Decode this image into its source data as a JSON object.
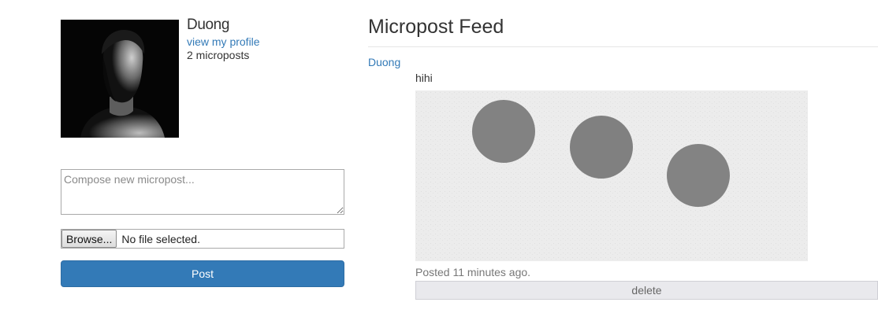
{
  "user": {
    "name": "Duong",
    "profile_link": "view my profile",
    "micropost_count": "2 microposts"
  },
  "compose": {
    "placeholder": "Compose new micropost...",
    "browse_label": "Browse...",
    "file_status": "No file selected.",
    "post_label": "Post"
  },
  "feed": {
    "title": "Micropost Feed",
    "posts": [
      {
        "author": "Duong",
        "content": "hihi",
        "timestamp": "Posted 11 minutes ago.",
        "delete_label": "delete"
      }
    ]
  },
  "colors": {
    "link": "#337ab7",
    "primary_button": "#337ab7",
    "muted_text": "#777777"
  }
}
